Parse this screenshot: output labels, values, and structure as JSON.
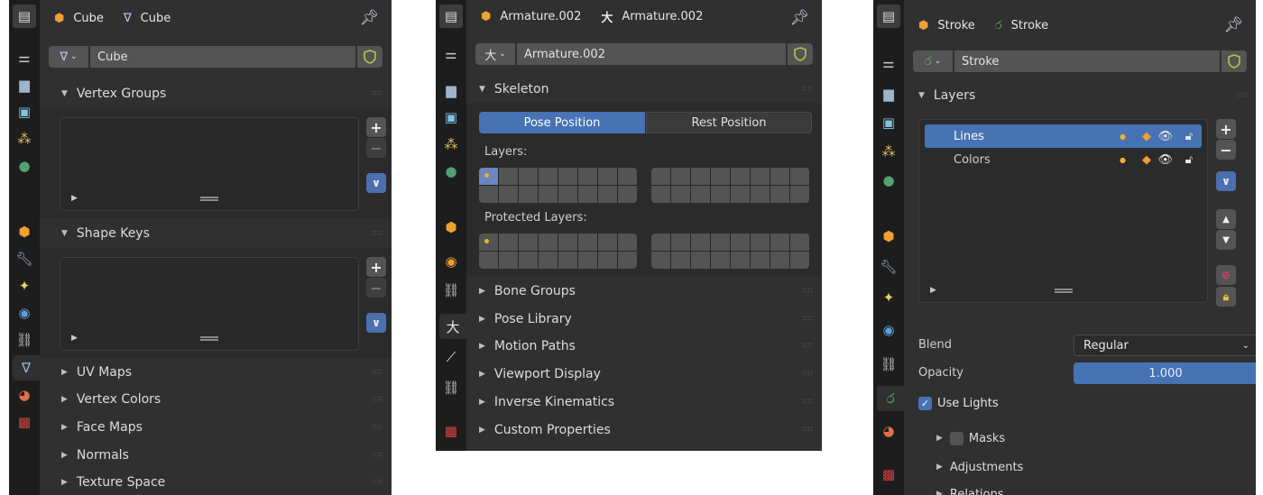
{
  "mesh_panel": {
    "header": {
      "object_name": "Cube",
      "data_name": "Cube"
    },
    "datablock": {
      "name": "Cube"
    },
    "sections": {
      "vertex_groups": "Vertex Groups",
      "shape_keys": "Shape Keys",
      "uv_maps": "UV Maps",
      "vertex_colors": "Vertex Colors",
      "face_maps": "Face Maps",
      "normals": "Normals",
      "texture_space": "Texture Space"
    }
  },
  "armature_panel": {
    "header": {
      "object_name": "Armature.002",
      "data_name": "Armature.002"
    },
    "datablock": {
      "name": "Armature.002"
    },
    "skeleton": {
      "title": "Skeleton",
      "pose_position": "Pose Position",
      "rest_position": "Rest Position",
      "layers_label": "Layers:",
      "protected_label": "Protected Layers:"
    },
    "sections": {
      "bone_groups": "Bone Groups",
      "pose_library": "Pose Library",
      "motion_paths": "Motion Paths",
      "viewport_display": "Viewport Display",
      "inverse_kinematics": "Inverse Kinematics",
      "custom_properties": "Custom Properties"
    }
  },
  "stroke_panel": {
    "header": {
      "object_name": "Stroke",
      "data_name": "Stroke"
    },
    "datablock": {
      "name": "Stroke"
    },
    "layers": {
      "title": "Layers",
      "items": [
        {
          "name": "Lines",
          "selected": true
        },
        {
          "name": "Colors",
          "selected": false
        }
      ]
    },
    "blend": {
      "label": "Blend",
      "value": "Regular"
    },
    "opacity": {
      "label": "Opacity",
      "value": "1.000"
    },
    "use_lights": {
      "label": "Use Lights",
      "checked": true
    },
    "sections": {
      "masks": "Masks",
      "adjustments": "Adjustments",
      "relations": "Relations"
    }
  },
  "colors": {
    "accent": "#4772b3",
    "panel_bg": "#303030",
    "tabbar_bg": "#1d1d1d",
    "object_orange": "#f0a030"
  }
}
